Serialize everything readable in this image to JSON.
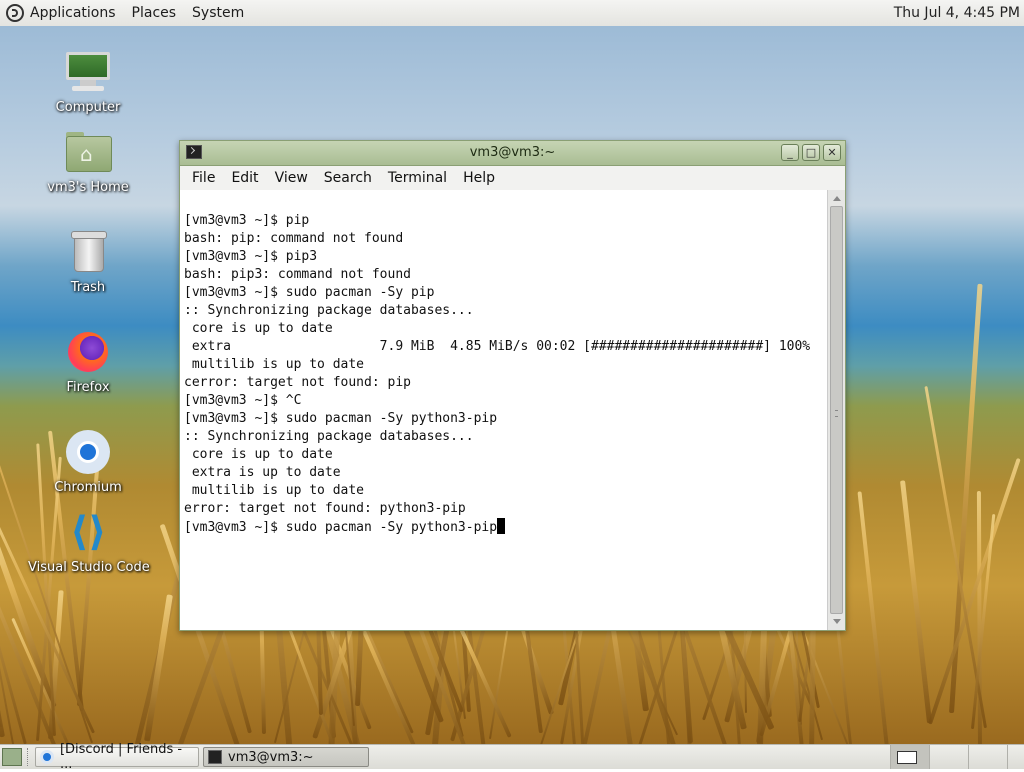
{
  "top_panel": {
    "menus": [
      "Applications",
      "Places",
      "System"
    ],
    "clock": "Thu Jul  4,  4:45 PM"
  },
  "desktop": {
    "icons": [
      {
        "label": "Computer",
        "icon": "computer-icon"
      },
      {
        "label": "vm3's Home",
        "icon": "home-folder-icon"
      },
      {
        "label": "Trash",
        "icon": "trash-icon"
      },
      {
        "label": "Firefox",
        "icon": "firefox-icon"
      },
      {
        "label": "Chromium",
        "icon": "chromium-icon"
      },
      {
        "label": "Visual Studio Code",
        "icon": "vscode-icon"
      }
    ]
  },
  "terminal": {
    "title": "vm3@vm3:~",
    "menu": [
      "File",
      "Edit",
      "View",
      "Search",
      "Terminal",
      "Help"
    ],
    "lines": [
      "[vm3@vm3 ~]$ pip",
      "bash: pip: command not found",
      "[vm3@vm3 ~]$ pip3",
      "bash: pip3: command not found",
      "[vm3@vm3 ~]$ sudo pacman -Sy pip",
      ":: Synchronizing package databases...",
      " core is up to date",
      " extra                   7.9 MiB  4.85 MiB/s 00:02 [######################] 100%",
      " multilib is up to date",
      "cerror: target not found: pip",
      "[vm3@vm3 ~]$ ^C",
      "[vm3@vm3 ~]$ sudo pacman -Sy python3-pip",
      ":: Synchronizing package databases...",
      " core is up to date",
      " extra is up to date",
      " multilib is up to date",
      "error: target not found: python3-pip"
    ],
    "prompt_line": "[vm3@vm3 ~]$ sudo pacman -Sy python3-pip"
  },
  "taskbar": {
    "tasks": [
      {
        "label": "[Discord | Friends - ...",
        "icon": "chromium-icon"
      },
      {
        "label": "vm3@vm3:~",
        "icon": "terminal-icon"
      }
    ],
    "workspaces": 4
  },
  "colors": {
    "panel": "#e8e8e4",
    "titlebar": "#b4c59f",
    "terminal_bg": "#ffffff",
    "terminal_fg": "#111111"
  }
}
